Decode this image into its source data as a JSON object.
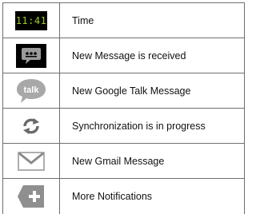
{
  "rows": [
    {
      "icon": "status-clock-icon",
      "icon_text": "11:41",
      "label": "Time"
    },
    {
      "icon": "message-bubble-icon",
      "label": "New Message is received"
    },
    {
      "icon": "google-talk-icon",
      "icon_text": "talk",
      "label": "New Google Talk Message"
    },
    {
      "icon": "sync-arrows-icon",
      "label": "Synchronization is in progress"
    },
    {
      "icon": "gmail-envelope-icon",
      "label": "New Gmail Message"
    },
    {
      "icon": "more-notifications-plus-icon",
      "label": "More Notifications"
    }
  ],
  "colors": {
    "border": "#6f6f6f",
    "clock_text": "#9ccc2a",
    "icon_gray": "#8a8a8a"
  }
}
